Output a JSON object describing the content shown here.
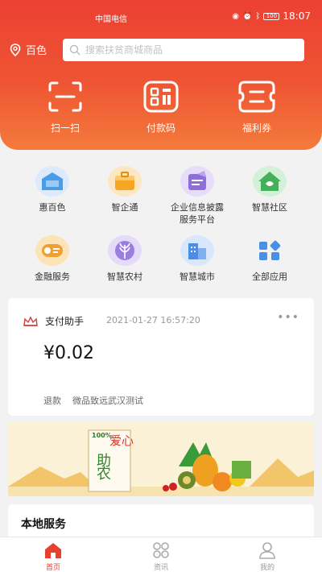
{
  "status_bar": {
    "carrier": "中国电信",
    "network": "4G",
    "battery": "100",
    "time": "18:07"
  },
  "header": {
    "location": "百色",
    "search_placeholder": "搜索扶贫商城商品",
    "quick_actions": [
      {
        "label": "扫一扫",
        "icon": "scan-icon"
      },
      {
        "label": "付款码",
        "icon": "pay-code-icon"
      },
      {
        "label": "福利券",
        "icon": "coupon-icon"
      }
    ]
  },
  "services": [
    {
      "label": "惠百色",
      "icon": "hui-baise-icon",
      "color": "#4a9be8"
    },
    {
      "label": "智企通",
      "icon": "enterprise-icon",
      "color": "#f5a623"
    },
    {
      "label": "企业信息披露服务平台",
      "line1": "企业信息披露",
      "line2": "服务平台",
      "icon": "info-disclosure-icon",
      "color": "#8e6fd8"
    },
    {
      "label": "智慧社区",
      "icon": "community-icon",
      "color": "#45b05a"
    },
    {
      "label": "金融服务",
      "icon": "finance-icon",
      "color": "#f0a030"
    },
    {
      "label": "智慧农村",
      "icon": "rural-icon",
      "color": "#9a7ee0"
    },
    {
      "label": "智慧城市",
      "icon": "city-icon",
      "color": "#4a8ee8"
    },
    {
      "label": "全部应用",
      "icon": "all-apps-icon",
      "color": "#4a8ee8"
    }
  ],
  "payment_card": {
    "title": "支付助手",
    "datetime": "2021-01-27 16:57:20",
    "amount": "¥0.02",
    "status": "退款",
    "merchant": "微品致远武汉测试"
  },
  "banner": {
    "text_top": "爱心",
    "text_bottom": "助农",
    "badge": "100%"
  },
  "local_services": {
    "title": "本地服务"
  },
  "tabbar": [
    {
      "label": "首页",
      "icon": "home-icon",
      "active": true
    },
    {
      "label": "资讯",
      "icon": "news-icon",
      "active": false
    },
    {
      "label": "我的",
      "icon": "profile-icon",
      "active": false
    }
  ]
}
